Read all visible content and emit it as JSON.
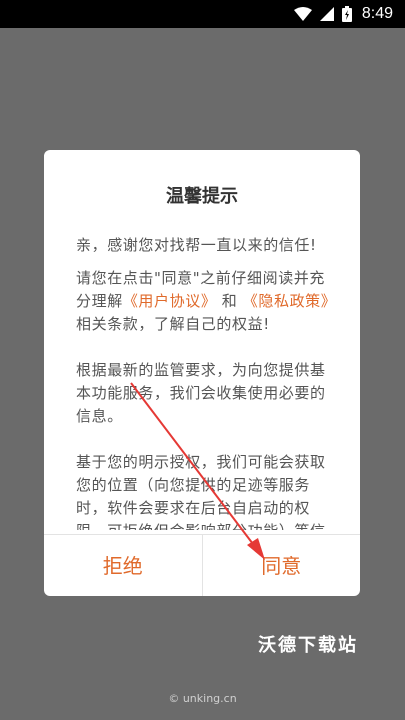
{
  "status_bar": {
    "time": "8:49",
    "icons": [
      "wifi-icon",
      "signal-icon",
      "battery-icon"
    ]
  },
  "dialog": {
    "title": "温馨提示",
    "greeting": "亲，感谢您对找帮一直以来的信任!",
    "agreement": {
      "prefix": "请您在点击\"同意\"之前仔细阅读并充分理解",
      "user_agreement": "《用户协议》",
      "and": "和",
      "privacy_policy": "《隐私政策》",
      "suffix": "相关条款，了解自己的权益!"
    },
    "regulation": "根据最新的监管要求，为向您提供基本功能服务，我们会收集使用必要的信息。",
    "location": "基于您的明示授权，我们可能会获取您的位置（向您提供的足迹等服务时，软件会要求在后台自启动的权限，可拒绝但会影响部分功能）等信",
    "decline_label": "拒绝",
    "agree_label": "同意"
  },
  "watermark": {
    "logo_text": "沃德下载站",
    "url": "© unking.cn"
  },
  "colors": {
    "accent": "#e06a2b",
    "overlay": "#6b6b6b",
    "arrow": "#e53935"
  }
}
